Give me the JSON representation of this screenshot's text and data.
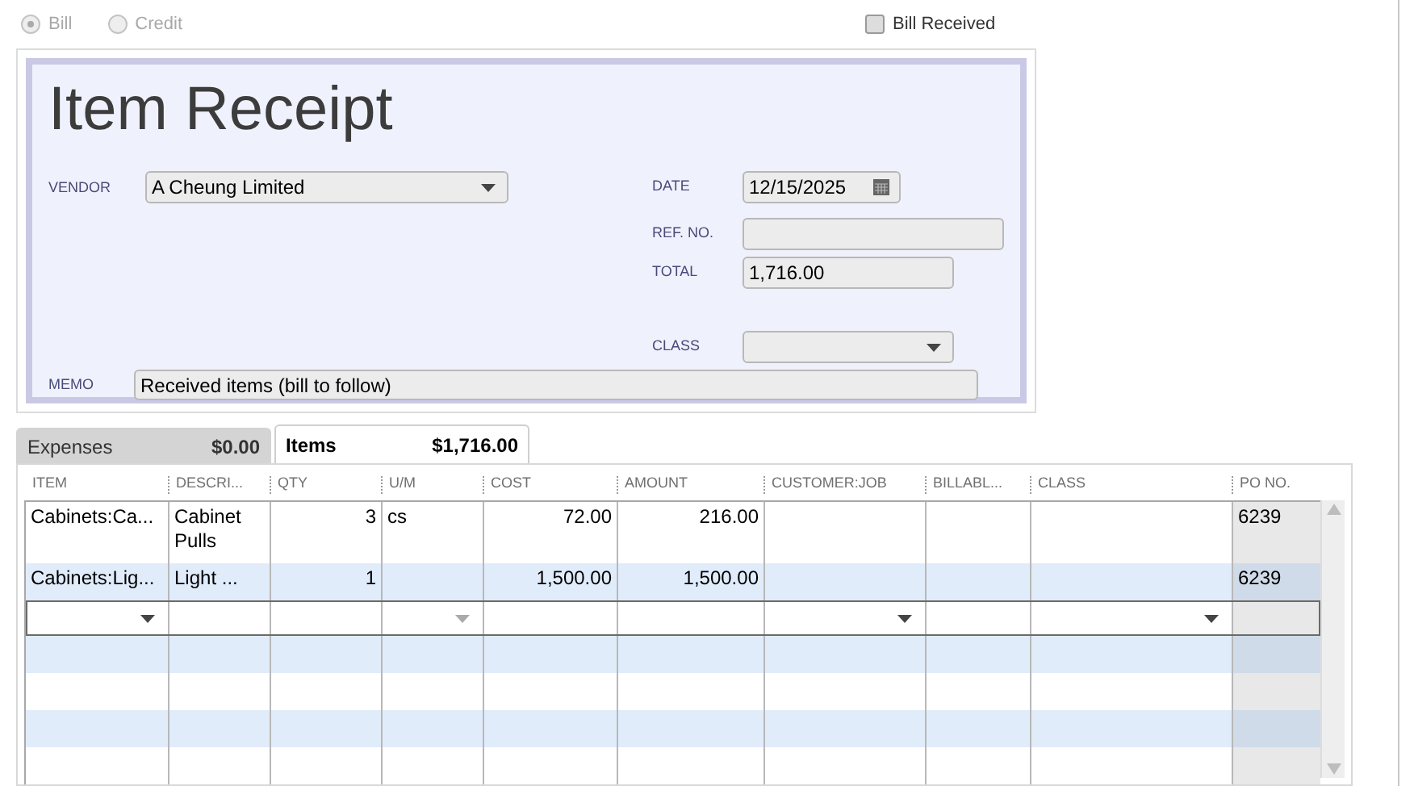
{
  "transaction_type": [
    {
      "label": "Bill",
      "selected": true
    },
    {
      "label": "Credit",
      "selected": false
    }
  ],
  "bill_received": {
    "label": "Bill Received",
    "checked": false
  },
  "form": {
    "title": "Item Receipt",
    "vendor": {
      "label": "VENDOR",
      "value": "A Cheung Limited",
      "kind": "dropdown"
    },
    "right_fields": [
      {
        "label": "DATE",
        "value": "12/15/2025",
        "kind": "date"
      },
      {
        "label": "REF. NO.",
        "kind": "text"
      },
      {
        "label": "TOTAL",
        "value": "1,716.00",
        "kind": "text"
      },
      {
        "label": "CLASS",
        "kind": "dropdown"
      }
    ],
    "memo": {
      "label": "MEMO",
      "value": "Received items (bill to follow)"
    }
  },
  "tabs": [
    {
      "label": "Expenses",
      "amount": "$0.00",
      "selected": false
    },
    {
      "label": "Items",
      "amount": "$1,716.00",
      "selected": true
    }
  ],
  "table": {
    "columns": [
      "ITEM",
      "DESCRI...",
      "QTY",
      "U/M",
      "COST",
      "AMOUNT",
      "CUSTOMER:JOB",
      "BILLABL...",
      "CLASS",
      "PO NO."
    ],
    "rows": [
      {
        "item": "Cabinets:Ca...",
        "description": "Cabinet Pulls",
        "qty": "3",
        "um": "cs",
        "cost": "72.00",
        "amount": "216.00",
        "po_no": "6239"
      },
      {
        "item": "Cabinets:Lig...",
        "description": "Light ...",
        "qty": "1",
        "cost": "1,500.00",
        "amount": "1,500.00",
        "po_no": "6239"
      }
    ]
  }
}
